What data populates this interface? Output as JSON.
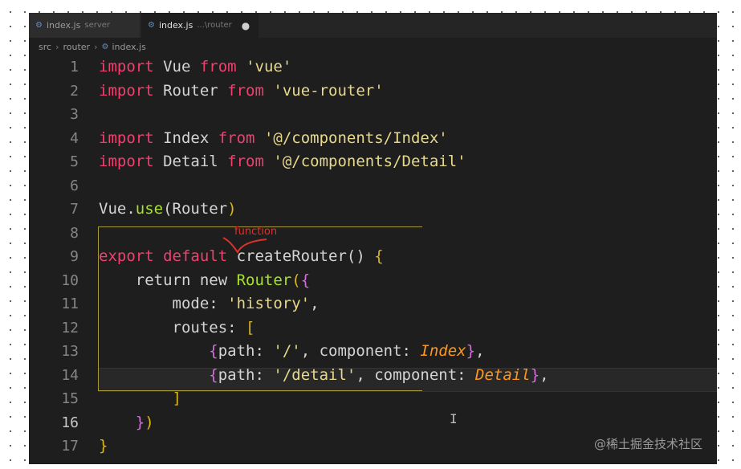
{
  "tabs": [
    {
      "icon": "gear-file-icon",
      "name": "index.js",
      "desc": "server",
      "modified": false
    },
    {
      "icon": "gear-file-icon",
      "name": "index.js",
      "desc": "...\\router",
      "modified": true
    }
  ],
  "breadcrumb": [
    "src",
    "router",
    "index.js"
  ],
  "annotation": "function",
  "watermark": "@稀土掘金技术社区",
  "code": {
    "lines": [
      {
        "n": "1",
        "tokens": [
          [
            "import",
            "kw-red"
          ],
          [
            " Vue ",
            ""
          ],
          [
            "from",
            "kw-red"
          ],
          [
            " ",
            ""
          ],
          [
            "'vue'",
            "str"
          ]
        ]
      },
      {
        "n": "2",
        "tokens": [
          [
            "import",
            "kw-red"
          ],
          [
            " Router ",
            ""
          ],
          [
            "from",
            "kw-red"
          ],
          [
            " ",
            ""
          ],
          [
            "'vue-router'",
            "str"
          ]
        ]
      },
      {
        "n": "3",
        "tokens": []
      },
      {
        "n": "4",
        "tokens": [
          [
            "import",
            "kw-red"
          ],
          [
            " Index ",
            ""
          ],
          [
            "from",
            "kw-red"
          ],
          [
            " ",
            ""
          ],
          [
            "'@/components/Index'",
            "str"
          ]
        ]
      },
      {
        "n": "5",
        "tokens": [
          [
            "import",
            "kw-red"
          ],
          [
            " Detail ",
            ""
          ],
          [
            "from",
            "kw-red"
          ],
          [
            " ",
            ""
          ],
          [
            "'@/components/Detail'",
            "str"
          ]
        ]
      },
      {
        "n": "6",
        "tokens": []
      },
      {
        "n": "7",
        "tokens": [
          [
            "Vue.",
            ""
          ],
          [
            "use",
            "fn"
          ],
          [
            "(Router",
            ""
          ],
          [
            ")",
            "brace"
          ]
        ]
      },
      {
        "n": "8",
        "tokens": []
      },
      {
        "n": "9",
        "tokens": [
          [
            "export",
            "kw-red"
          ],
          [
            " ",
            ""
          ],
          [
            "default",
            "kw-red"
          ],
          [
            " createRouter() ",
            ""
          ],
          [
            "{",
            "brace"
          ]
        ]
      },
      {
        "n": "10",
        "tokens": [
          [
            "    return new ",
            ""
          ],
          [
            "Router",
            "cls"
          ],
          [
            "(",
            "brace"
          ],
          [
            "{",
            "brace2"
          ]
        ]
      },
      {
        "n": "11",
        "tokens": [
          [
            "        mode: ",
            ""
          ],
          [
            "'history'",
            "str"
          ],
          [
            ",",
            ""
          ]
        ]
      },
      {
        "n": "12",
        "tokens": [
          [
            "        routes: ",
            ""
          ],
          [
            "[",
            "brace"
          ]
        ]
      },
      {
        "n": "13",
        "tokens": [
          [
            "            ",
            ""
          ],
          [
            "{",
            "brace2"
          ],
          [
            "path: ",
            ""
          ],
          [
            "'/'",
            "str"
          ],
          [
            ", component: ",
            ""
          ],
          [
            "Index",
            "comp"
          ],
          [
            "}",
            "brace2"
          ],
          [
            ",",
            ""
          ]
        ]
      },
      {
        "n": "14",
        "tokens": [
          [
            "            ",
            ""
          ],
          [
            "{",
            "brace2"
          ],
          [
            "path: ",
            ""
          ],
          [
            "'/detail'",
            "str"
          ],
          [
            ", component: ",
            ""
          ],
          [
            "Detail",
            "comp"
          ],
          [
            "}",
            "brace2"
          ],
          [
            ",",
            ""
          ]
        ]
      },
      {
        "n": "15",
        "tokens": [
          [
            "        ",
            ""
          ],
          [
            "]",
            "brace"
          ]
        ]
      },
      {
        "n": "16",
        "tokens": [
          [
            "    ",
            ""
          ],
          [
            "}",
            "brace2"
          ],
          [
            ")",
            "brace"
          ]
        ],
        "active": true
      },
      {
        "n": "17",
        "tokens": [
          [
            "}",
            "brace"
          ]
        ]
      }
    ]
  }
}
